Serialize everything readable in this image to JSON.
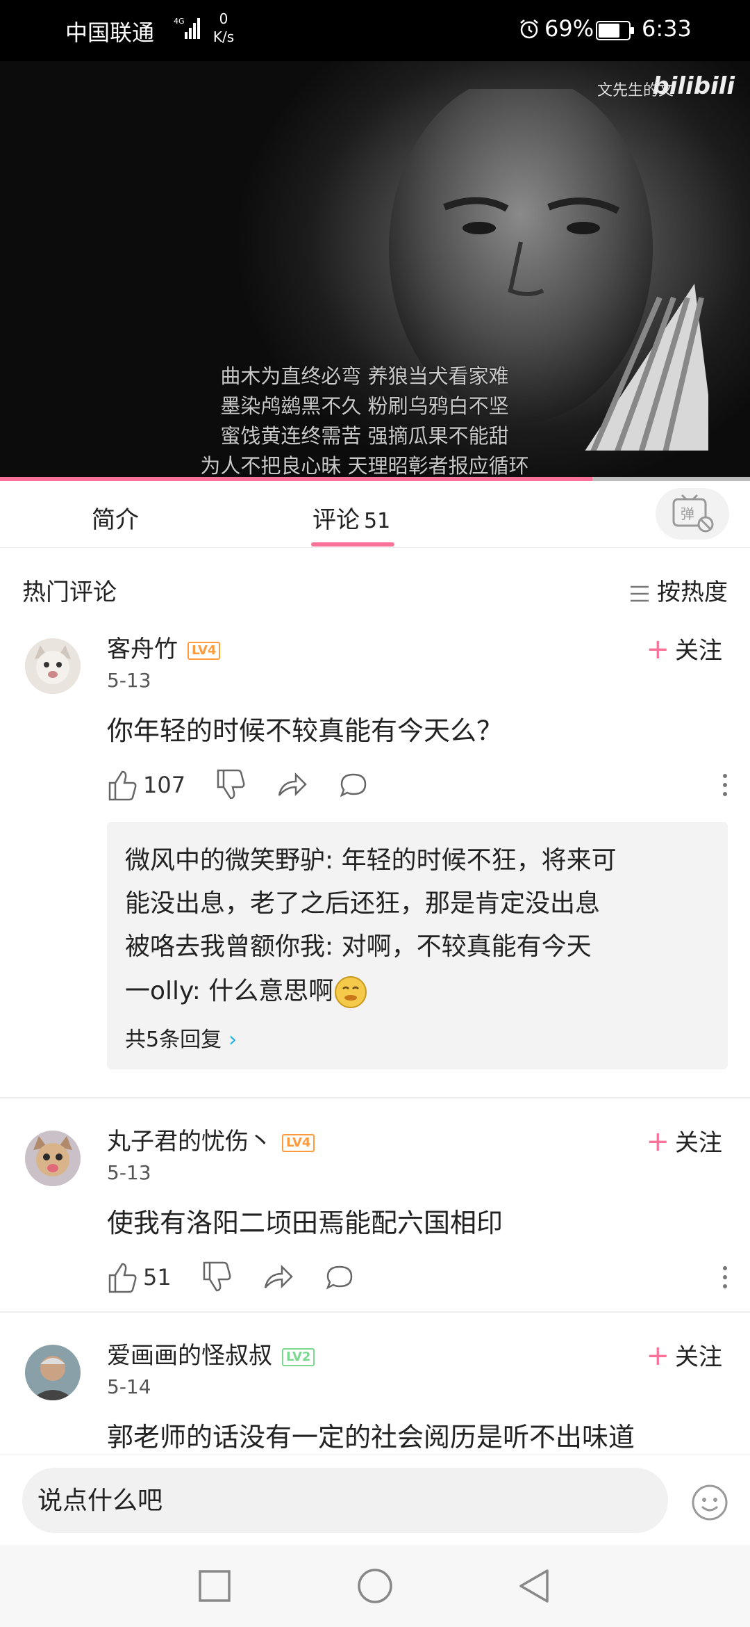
{
  "status_bar": {
    "carrier": "中国联通",
    "speed_value": "0",
    "speed_unit": "K/s",
    "battery": "69%",
    "time": "6:33",
    "icons": [
      "signal-4g-icon",
      "alarm-icon",
      "battery-icon"
    ]
  },
  "video": {
    "watermark_text": "文先生的文",
    "watermark_logo": "bilibili",
    "subtitles": [
      "曲木为直终必弯 养狼当犬看家难",
      "墨染鸬鹚黑不久 粉刷乌鸦白不坚",
      "蜜饯黄连终需苦 强摘瓜果不能甜",
      "为人不把良心昧 天理昭彰者报应循环"
    ],
    "progress": 0.79
  },
  "tabs": {
    "intro": "简介",
    "comments": "评论",
    "comments_count": "51",
    "danmaku_icon": "danmaku-toggle-icon"
  },
  "section": {
    "title": "热门评论",
    "sort_label": "按热度"
  },
  "comments": [
    {
      "username": "客舟竹",
      "level": "LV4",
      "date": "5-13",
      "follow": "关注",
      "text": "你年轻的时候不较真能有今天么？",
      "likes": "107",
      "replies": [
        "微风中的微笑野驴: 年轻的时候不狂，将来可",
        "能没出息，老了之后还狂，那是肯定没出息",
        "被咯去我曾额你我: 对啊，不较真能有今天",
        "一olly: 什么意思啊"
      ],
      "reply_more": "共5条回复"
    },
    {
      "username": "丸子君的忧伤丶",
      "level": "LV4",
      "date": "5-13",
      "follow": "关注",
      "text": "使我有洛阳二顷田焉能配六国相印",
      "likes": "51"
    },
    {
      "username": "爱画画的怪叔叔",
      "level": "LV2",
      "date": "5-14",
      "follow": "关注",
      "text": "郭老师的话没有一定的社会阅历是听不出味道"
    }
  ],
  "colors": {
    "accent_pink": "#fb7299",
    "level4": "#ff9b3d",
    "level2": "#7bd88f",
    "link_blue": "#23ade5"
  },
  "input": {
    "placeholder": "说点什么吧"
  }
}
